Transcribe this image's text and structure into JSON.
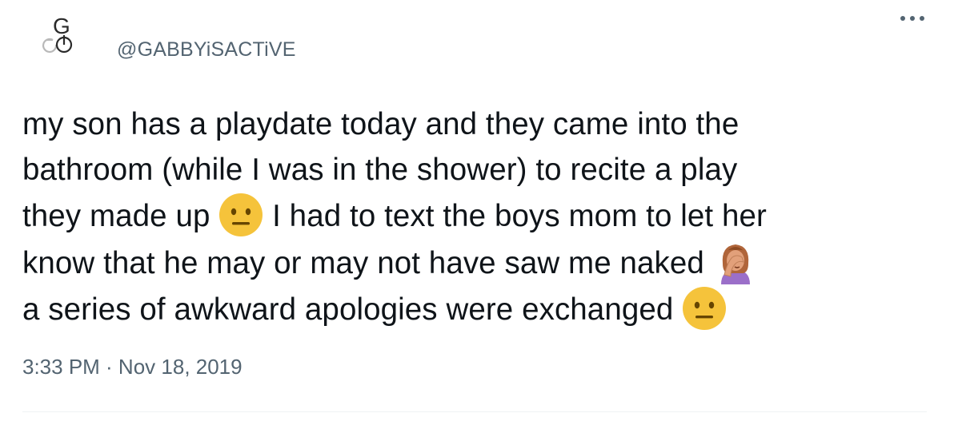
{
  "tweet": {
    "author": {
      "handle": "@GABBYiSACTiVE",
      "avatar_icon": "gabby-logo-icon",
      "avatar_logo_text": "G"
    },
    "more_icon": "more-options-icon",
    "text_lines": [
      "my son has a playdate today and they came into the",
      "bathroom (while I was in the shower) to recite a play",
      "they made up",
      "I had to text the boys mom to let her",
      "know that he may or may not have saw me naked",
      "a series of awkward apologies were exchanged"
    ],
    "emojis": {
      "neutral_face": "neutral-face-icon",
      "facepalm": "woman-facepalming-icon"
    },
    "timestamp": "3:33 PM · Nov 18, 2019"
  },
  "colors": {
    "text": "#0f1419",
    "secondary": "#536471",
    "divider": "#eff3f4",
    "emoji_yellow": "#f5c33b"
  }
}
